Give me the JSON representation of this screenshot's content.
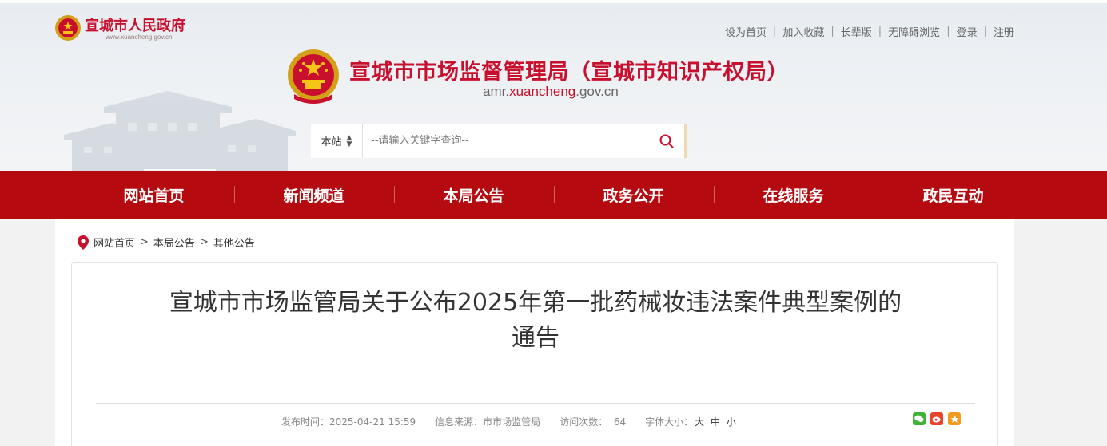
{
  "header": {
    "gov_title": "宣城市人民政府",
    "gov_url": "www.xuancheng.gov.cn",
    "site_title": "宣城市市场监督管理局（宣城市知识产权局）",
    "site_url_prefix": "amr.",
    "site_url_highlight": "xuancheng",
    "site_url_suffix": ".gov.cn",
    "toplinks": [
      "设为首页",
      "加入收藏",
      "长辈版",
      "无障碍浏览",
      "登录",
      "注册"
    ]
  },
  "search": {
    "scope": "本站",
    "placeholder": "--请输入关键字查询--"
  },
  "nav": [
    "网站首页",
    "新闻频道",
    "本局公告",
    "政务公开",
    "在线服务",
    "政民互动"
  ],
  "breadcrumb": [
    "网站首页",
    "本局公告",
    "其他公告"
  ],
  "article": {
    "title": "宣城市市场监管局关于公布2025年第一批药械妆违法案件典型案例的通告",
    "publish_label": "发布时间：",
    "publish_time": "2025-04-21 15:59",
    "source_label": "信息来源：",
    "source": "市市场监管局",
    "visits_label": "访问次数：",
    "visits": "64",
    "fontsize_label": "字体大小：",
    "font_sizes": [
      "大",
      "中",
      "小"
    ]
  },
  "colors": {
    "brand_red": "#b50a0f",
    "title_red": "#c8102e"
  }
}
